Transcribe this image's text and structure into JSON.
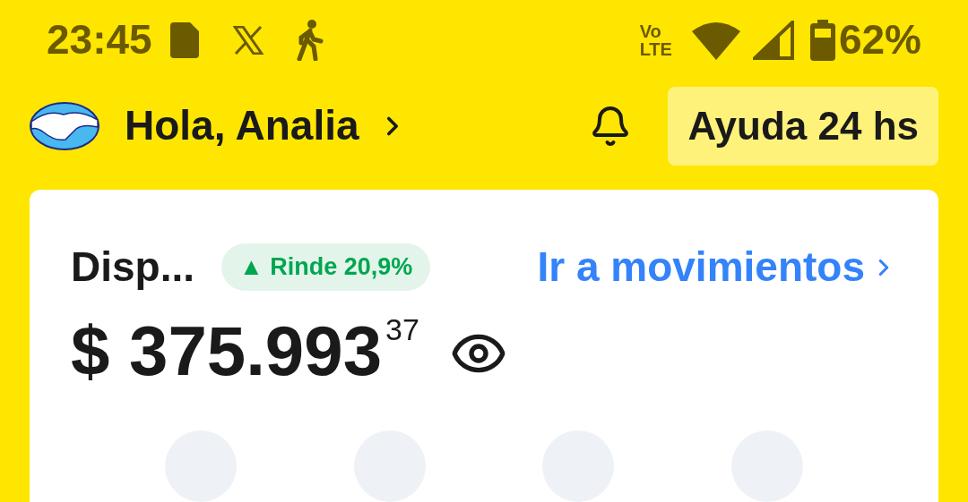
{
  "status_bar": {
    "time": "23:45",
    "network_label_top": "Vo",
    "network_label_bottom": "LTE",
    "battery": "62%"
  },
  "header": {
    "greeting": "Hola, Analia",
    "help_button": "Ayuda 24 hs"
  },
  "balance_card": {
    "title": "Disp...",
    "badge": "▲ Rinde 20,9%",
    "link": "Ir a movimientos",
    "currency": "$",
    "amount": "375.993",
    "cents": "37"
  },
  "shortcuts": [
    {
      "kind": "circle"
    },
    {
      "kind": "circle"
    },
    {
      "kind": "circle"
    },
    {
      "kind": "circle"
    }
  ]
}
